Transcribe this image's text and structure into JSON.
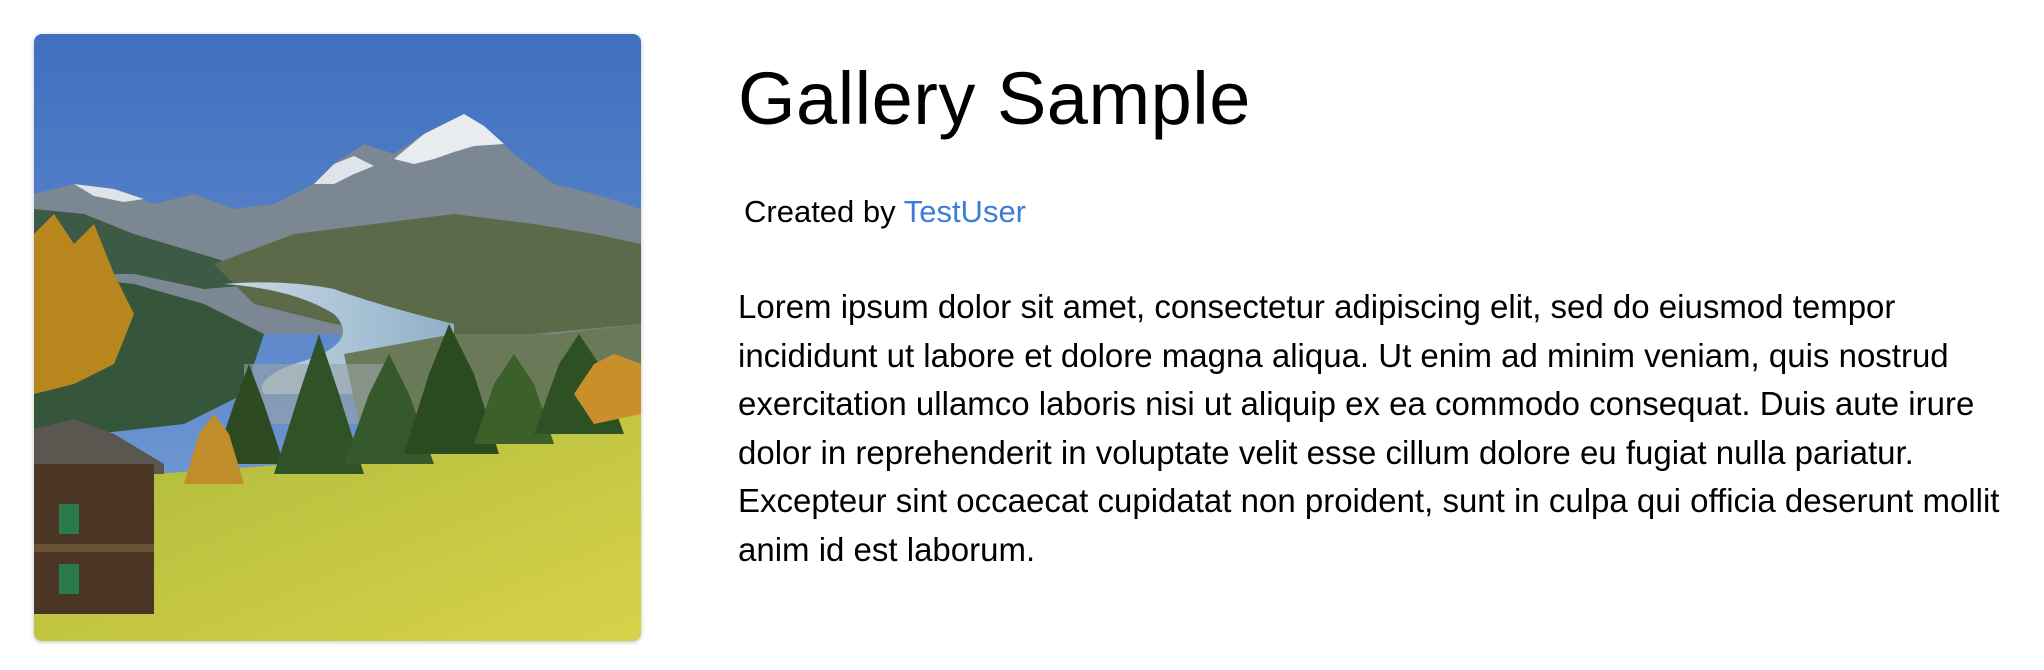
{
  "gallery": {
    "title": "Gallery Sample",
    "created_by_label": "Created by",
    "author": "TestUser",
    "description": "Lorem ipsum dolor sit amet, consectetur adipiscing elit, sed do eiusmod tempor incididunt ut labore et dolore magna aliqua. Ut enim ad minim veniam, quis nostrud exercitation ullamco laboris nisi ut aliquip ex ea commodo consequat. Duis aute irure dolor in reprehenderit in voluptate velit esse cillum dolore eu fugiat nulla pariatur. Excepteur sint occaecat cupidatat non proident, sunt in culpa qui officia deserunt mollit anim id est laborum."
  },
  "colors": {
    "link": "#3b7dd8",
    "text": "#000000",
    "background": "#ffffff"
  }
}
